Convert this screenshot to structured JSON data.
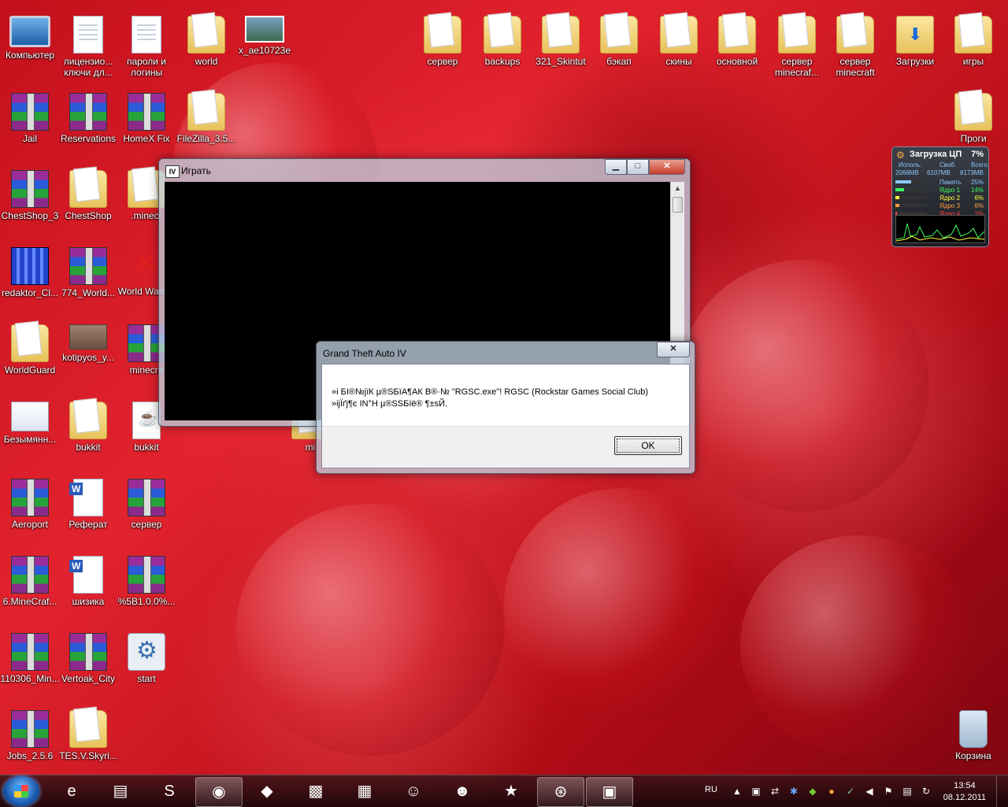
{
  "desktop_icons": [
    {
      "label": "Компьютер",
      "type": "pc"
    },
    {
      "label": "лицензио... ключи дл...",
      "type": "doc"
    },
    {
      "label": "пароли и логины",
      "type": "doc"
    },
    {
      "label": "world",
      "type": "folder"
    },
    {
      "label": "x_ae10723e",
      "type": "photo"
    },
    {
      "label": "Jail",
      "type": "rar"
    },
    {
      "label": "Reservations",
      "type": "rar"
    },
    {
      "label": "HomeX Fix",
      "type": "rar"
    },
    {
      "label": "FileZilla_3.5...",
      "type": "folder"
    },
    {
      "label": "ChestShop_3",
      "type": "rar"
    },
    {
      "label": "ChestShop",
      "type": "folder"
    },
    {
      "label": ".minecr",
      "type": "folder"
    },
    {
      "label": "redaktor_Cl...",
      "type": "blue"
    },
    {
      "label": "774_World...",
      "type": "rar"
    },
    {
      "label": "World Warcra",
      "type": "x"
    },
    {
      "label": "WorldGuard",
      "type": "folder"
    },
    {
      "label": "kotipyos_y...",
      "type": "cat"
    },
    {
      "label": "minecra",
      "type": "rar"
    },
    {
      "label": "Безымянн...",
      "type": "blank"
    },
    {
      "label": "bukkit",
      "type": "folder"
    },
    {
      "label": "bukkit",
      "type": "java"
    },
    {
      "label": "Aeroport",
      "type": "rar"
    },
    {
      "label": "Реферат",
      "type": "word"
    },
    {
      "label": "сервер",
      "type": "rar"
    },
    {
      "label": "6.MineCraf...",
      "type": "rar"
    },
    {
      "label": "шизика",
      "type": "word"
    },
    {
      "label": "%5B1.0.0%...",
      "type": "rar"
    },
    {
      "label": "110306_Min...",
      "type": "rar"
    },
    {
      "label": "Vertoak_City",
      "type": "rar"
    },
    {
      "label": "start",
      "type": "gear"
    },
    {
      "label": "Jobs_2.5.6",
      "type": "rar"
    },
    {
      "label": "TES.V.Skyri...",
      "type": "folder"
    },
    {
      "label": "сервер",
      "type": "folder"
    },
    {
      "label": "backups",
      "type": "folder"
    },
    {
      "label": "321_Skintut",
      "type": "folder"
    },
    {
      "label": "бэкап",
      "type": "folder"
    },
    {
      "label": "скины",
      "type": "folder"
    },
    {
      "label": "основной",
      "type": "folder"
    },
    {
      "label": "сервер minecraf...",
      "type": "folder"
    },
    {
      "label": "сервер minecraft",
      "type": "folder"
    },
    {
      "label": "Загрузки",
      "type": "dl"
    },
    {
      "label": "игры",
      "type": "folder"
    },
    {
      "label": "Проги",
      "type": "folder"
    },
    {
      "label": "Корзина",
      "type": "bin"
    },
    {
      "label": "mi",
      "type": "folder"
    }
  ],
  "play_window": {
    "title": "Играть",
    "icon": "IV"
  },
  "dialog": {
    "title": "Grand Theft Auto IV",
    "message_line1": "»і БІ®№јїК µ®ЅБїА¶АК В®·№ \"RGSC.exe\"! RGSC (Rockstar Games Social Club)",
    "message_line2": "»іјЇґј¶є ІN°Н µ®ЅЅБїё® ¶±sЙ.",
    "ok_label": "OK"
  },
  "cpu_gadget": {
    "title": "Загрузка ЦП",
    "total": "7%",
    "col1": "Исполь.",
    "col2": "Своб.",
    "col3": "Всего",
    "v1": "2066MB",
    "v2": "6107MB",
    "v3": "8173MB",
    "memory_label": "Память",
    "memory_pct": "25%",
    "memory_level": 25,
    "cores": [
      {
        "label": "Ядро 1",
        "pct": "14%",
        "level": 14,
        "color": "#40ff60"
      },
      {
        "label": "Ядро 2",
        "pct": "6%",
        "level": 6,
        "color": "#ffff40"
      },
      {
        "label": "Ядро 3",
        "pct": "6%",
        "level": 6,
        "color": "#ffa040"
      },
      {
        "label": "Ядро 4",
        "pct": "1%",
        "level": 1,
        "color": "#ff4040"
      }
    ]
  },
  "taskbar": {
    "items": [
      {
        "name": "ie",
        "glyph": "e",
        "active": false
      },
      {
        "name": "explorer",
        "glyph": "▤",
        "active": false
      },
      {
        "name": "skype",
        "glyph": "S",
        "active": false
      },
      {
        "name": "chrome",
        "glyph": "◉",
        "active": true
      },
      {
        "name": "app-1",
        "glyph": "◆",
        "active": false
      },
      {
        "name": "minecraft-block",
        "glyph": "▩",
        "active": false
      },
      {
        "name": "minecraft-grass",
        "glyph": "▦",
        "active": false
      },
      {
        "name": "game-1",
        "glyph": "☺",
        "active": false
      },
      {
        "name": "game-2",
        "glyph": "☻",
        "active": false
      },
      {
        "name": "star-game",
        "glyph": "★",
        "active": false
      },
      {
        "name": "steam",
        "glyph": "⊛",
        "active": true
      },
      {
        "name": "window",
        "glyph": "▣",
        "active": true
      }
    ],
    "lang": "RU",
    "time": "13:54",
    "date": "08.12.2011"
  }
}
